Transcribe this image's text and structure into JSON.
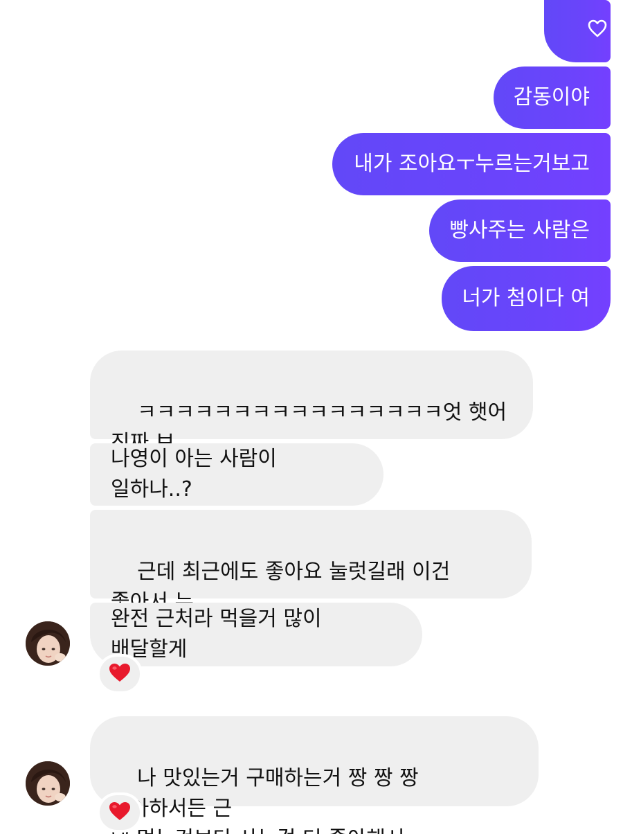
{
  "outgoing": [
    {
      "text": "",
      "icon": "heart-outline-icon"
    },
    {
      "text": "감동이야"
    },
    {
      "text": "내가 조아요ㅜ누르는거보고"
    },
    {
      "text": "빵사주는 사람은"
    },
    {
      "text": "너가 첨이다 여"
    }
  ],
  "incoming": [
    {
      "text": "ㅋㅋㅋㅋㅋㅋㅋㅋㅋㅋㅋㅋㅋㅋㅋㅋ엇 햇어 진짜 보\n고"
    },
    {
      "text": "나영이 아는 사람이 일하나..?"
    },
    {
      "text": "근데 최근에도 좋아요 눌럿길래 이건 좋아서 누\n른거다 싶엇지"
    },
    {
      "text": "완전 근처라 먹을거 많이 배달할게",
      "reaction": "red-heart"
    },
    {
      "text": "나 맛있는거 구매하는거 짱 짱 짱 좋아하서든 근\n데 먹는것보단 사는걸 더 좋아해서",
      "reaction": "red-heart"
    }
  ],
  "colors": {
    "outgoing_bubble": "#6a44fb",
    "incoming_bubble": "#efefef",
    "reaction_heart": "#e8192c"
  }
}
